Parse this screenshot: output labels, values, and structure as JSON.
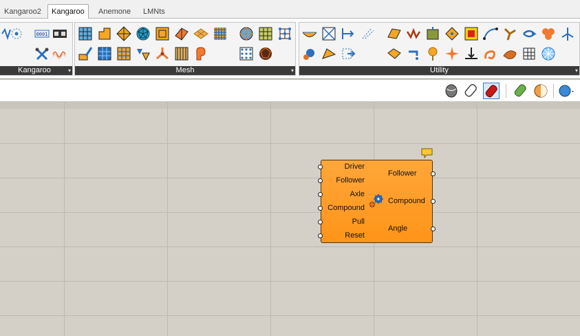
{
  "tabs": [
    {
      "label": "Kangaroo2",
      "active": false
    },
    {
      "label": "Kangaroo",
      "active": true
    },
    {
      "label": "Anemone",
      "active": false
    },
    {
      "label": "LMNts",
      "active": false
    }
  ],
  "panels": {
    "kangaroo": {
      "title": "Kangaroo"
    },
    "mesh": {
      "title": "Mesh"
    },
    "utility": {
      "title": "Utility"
    }
  },
  "toolbar_icons": {
    "kangaroo": [
      "spring-icon",
      "point-circle-icon",
      "binary-counter-icon",
      "film-frames-icon",
      "tools-icon",
      "wave-icon"
    ],
    "mesh": [
      "mesh-grid-icon",
      "mesh-corner-icon",
      "mesh-diamond-icon",
      "geodesic-sphere-icon",
      "mesh-frame-icon",
      "folded-plane-icon",
      "flat-tiles-icon",
      "blue-grid-icon",
      "triangulated-sphere-icon",
      "mesh-quad-grid-icon",
      "mesh-nodes-icon",
      "paint-brush-icon",
      "hex-mesh-icon",
      "mesh-lattice-icon",
      "triangle-split-icon",
      "tripod-icon",
      "mesh-box-icon",
      "roll-icon",
      "point-lattice-icon",
      "dark-sphere-icon"
    ],
    "utility": [
      "bowl-icon",
      "crossed-frame-icon",
      "arrow-bracket-icon",
      "sparkle-lines-icon",
      "gear-icon",
      "kite-icon",
      "arrow-frame-icon",
      "plane-icon",
      "crown-icon",
      "square-tree-icon",
      "diamond-nodes-icon",
      "colored-square-icon",
      "curve-nodes-icon",
      "pinwheel-icon",
      "refresh-arrows-icon",
      "flower-icon",
      "windmill-icon",
      "folded-card-icon",
      "faucet-icon",
      "pin-icon",
      "star-cross-icon",
      "anchor-arrow-icon",
      "spiral-icon",
      "shell-icon",
      "mesh-net-icon",
      "radial-snowflake-icon"
    ]
  },
  "subbar_icons": [
    "rhino-preview-icon",
    "wireframe-preview-icon",
    "shaded-preview-icon",
    "eraser-icon",
    "sphere-material-icon",
    "blue-sphere-icon"
  ],
  "component": {
    "inputs": [
      "Driver",
      "Follower",
      "Axle",
      "Compound",
      "Pull",
      "Reset"
    ],
    "outputs": [
      "Follower",
      "Compound",
      "Angle"
    ],
    "icon": "gear-icon",
    "balloon_icon": "message-balloon-icon"
  },
  "colors": {
    "component_fill": "#ff9418",
    "canvas": "#d4d0c8",
    "grid_line": "#bdb9b1",
    "panel_title_bar": "#3a3a3a"
  }
}
